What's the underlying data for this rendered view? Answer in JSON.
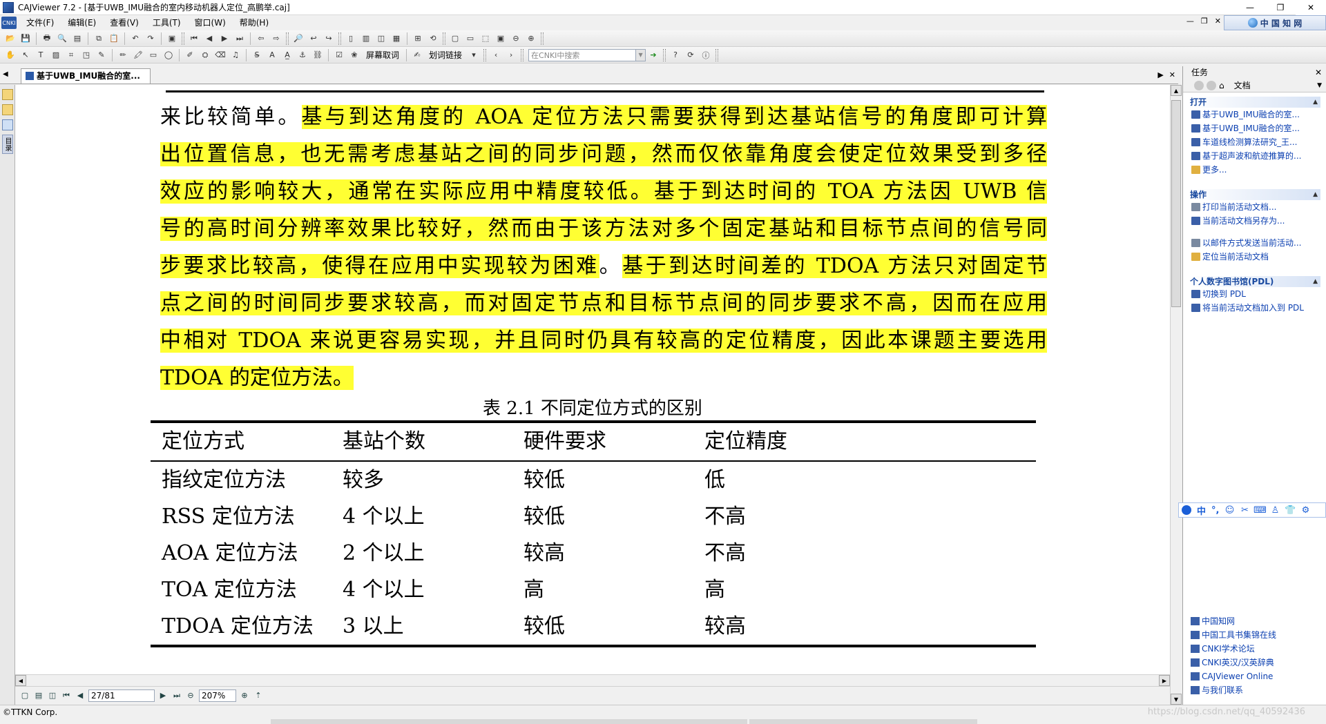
{
  "window": {
    "title": "CAJViewer 7.2 - [基于UWB_IMU融合的室内移动机器人定位_高鹏举.caj]",
    "controls": [
      "—",
      "❐",
      "✕"
    ]
  },
  "menubar": {
    "items": [
      "文件(F)",
      "编辑(E)",
      "查看(V)",
      "工具(T)",
      "窗口(W)",
      "帮助(H)"
    ],
    "mdi_controls": [
      "—",
      "❐",
      "✕"
    ],
    "cnki_label": "中 国 知 网"
  },
  "toolbar2": {
    "screen_capture_label": "屏幕取词",
    "word_link_label": "划词链接",
    "search_placeholder": "在CNKI中搜索"
  },
  "document_tab": {
    "label": "基于UWB_IMU融合的室...",
    "controls": [
      "▶",
      "✕"
    ]
  },
  "left_strip": {
    "toc_label": "目录"
  },
  "document": {
    "paragraph_lines": [
      [
        {
          "t": "来比较简单。",
          "h": false
        },
        {
          "t": "基与到达角度的 AOA 定位方法只需要获得到达基站信号的角度即可计算",
          "h": true
        }
      ],
      [
        {
          "t": "出位置信息，也无需考虑基站之间的同步问题，然而仅依靠角度会使定位效果受到多径",
          "h": true
        }
      ],
      [
        {
          "t": "效应的影响较大，通常在实际应用中精度较低。",
          "h": true
        },
        {
          "t": "基于到达时间的 TOA 方法因 UWB 信",
          "h": true
        }
      ],
      [
        {
          "t": "号的高时间分辨率效果比较好，然而由于该方法对多个固定基站和目标节点间的信号同",
          "h": true
        }
      ],
      [
        {
          "t": "步要求比较高，使得在应用中实现较为困难",
          "h": true
        },
        {
          "t": "。",
          "h": false
        },
        {
          "t": "基于到达时间差的 TDOA 方法只对固定节",
          "h": true
        }
      ],
      [
        {
          "t": "点之间的时间同步要求较高，而对固定节点和目标节点间的同步要求不高，因而在应用",
          "h": true
        }
      ],
      [
        {
          "t": "中相对 TDOA 来说更容易实现，并且同时仍具有较高的定位精度，因此本课题主要选用",
          "h": true
        }
      ],
      [
        {
          "t": "TDOA 的定位方法。",
          "h": true
        }
      ]
    ],
    "table_caption": "表  2.1  不同定位方式的区别",
    "table": {
      "headers": [
        "定位方式",
        "基站个数",
        "硬件要求",
        "定位精度"
      ],
      "rows": [
        [
          "指纹定位方法",
          "较多",
          "较低",
          "低"
        ],
        [
          "RSS 定位方法",
          "4 个以上",
          "较低",
          "不高"
        ],
        [
          "AOA 定位方法",
          "2 个以上",
          "较高",
          "不高"
        ],
        [
          "TOA 定位方法",
          "4 个以上",
          "高",
          "高"
        ],
        [
          "TDOA 定位方法",
          "3 以上",
          "较低",
          "较高"
        ]
      ]
    },
    "highlight_color": "#ffff33"
  },
  "pagenav": {
    "page_value": "27/81",
    "zoom_value": "207%"
  },
  "taskpanel": {
    "title": "任务",
    "nav_label": "文档",
    "sections": [
      {
        "title": "打开",
        "items": [
          {
            "label": "基于UWB_IMU融合的室...",
            "icon": "caj-file-icon"
          },
          {
            "label": "基于UWB_IMU融合的室...",
            "icon": "caj-file-icon"
          },
          {
            "label": "车道线检测算法研究_王...",
            "icon": "caj-file-icon"
          },
          {
            "label": "基于超声波和航迹推算的...",
            "icon": "caj-file-icon"
          },
          {
            "label": "更多...",
            "icon": "folder-icon"
          }
        ]
      },
      {
        "title": "操作",
        "items": [
          {
            "label": "打印当前活动文档...",
            "icon": "print-icon"
          },
          {
            "label": "当前活动文档另存为...",
            "icon": "save-icon"
          },
          {
            "label": "",
            "icon": ""
          },
          {
            "label": "以邮件方式发送当前活动...",
            "icon": "mail-icon"
          },
          {
            "label": "定位当前活动文档",
            "icon": "folder-icon"
          }
        ]
      },
      {
        "title": "个人数字图书馆(PDL)",
        "items": [
          {
            "label": "切换到 PDL",
            "icon": "pdl-icon"
          },
          {
            "label": "将当前活动文档加入到 PDL",
            "icon": "pdl-add-icon"
          }
        ]
      }
    ],
    "links": [
      "中国知网",
      "中国工具书集锦在线",
      "CNKI学术论坛",
      "CNKI英汉/汉英辞典",
      "CAJViewer Online",
      "与我们联系"
    ]
  },
  "ime_bar": {
    "mode_label": "中",
    "punct_label": "°,"
  },
  "statusbar": {
    "copyright": "©TTKN Corp.",
    "watermark": "https://blog.csdn.net/qq_40592436"
  }
}
